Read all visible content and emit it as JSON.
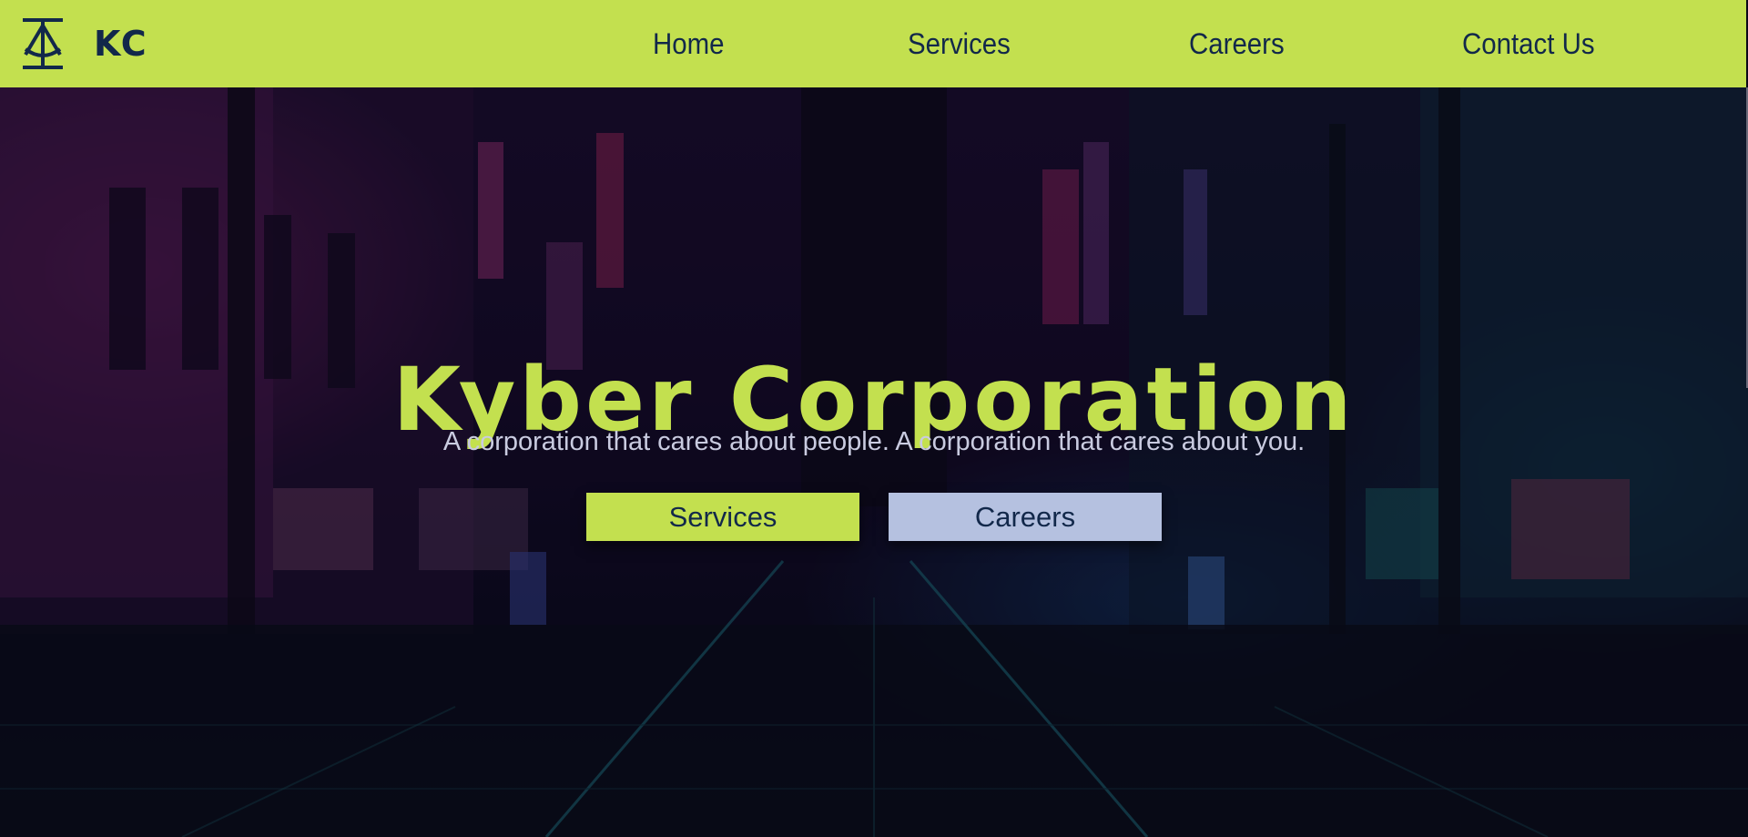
{
  "header": {
    "logo_text": "KC",
    "nav": [
      "Home",
      "Services",
      "Careers",
      "Contact Us"
    ]
  },
  "hero": {
    "title": "Kyber Corporation",
    "subtitle": "A corporation that cares about people. A corporation that cares about you.",
    "buttons": {
      "services": "Services",
      "careers": "Careers"
    }
  },
  "colors": {
    "accent_lime": "#c3e04f",
    "navy_text": "#12284a",
    "careers_button": "#b5c1e0"
  },
  "icons": {
    "logo": "anchor-logo-icon"
  }
}
